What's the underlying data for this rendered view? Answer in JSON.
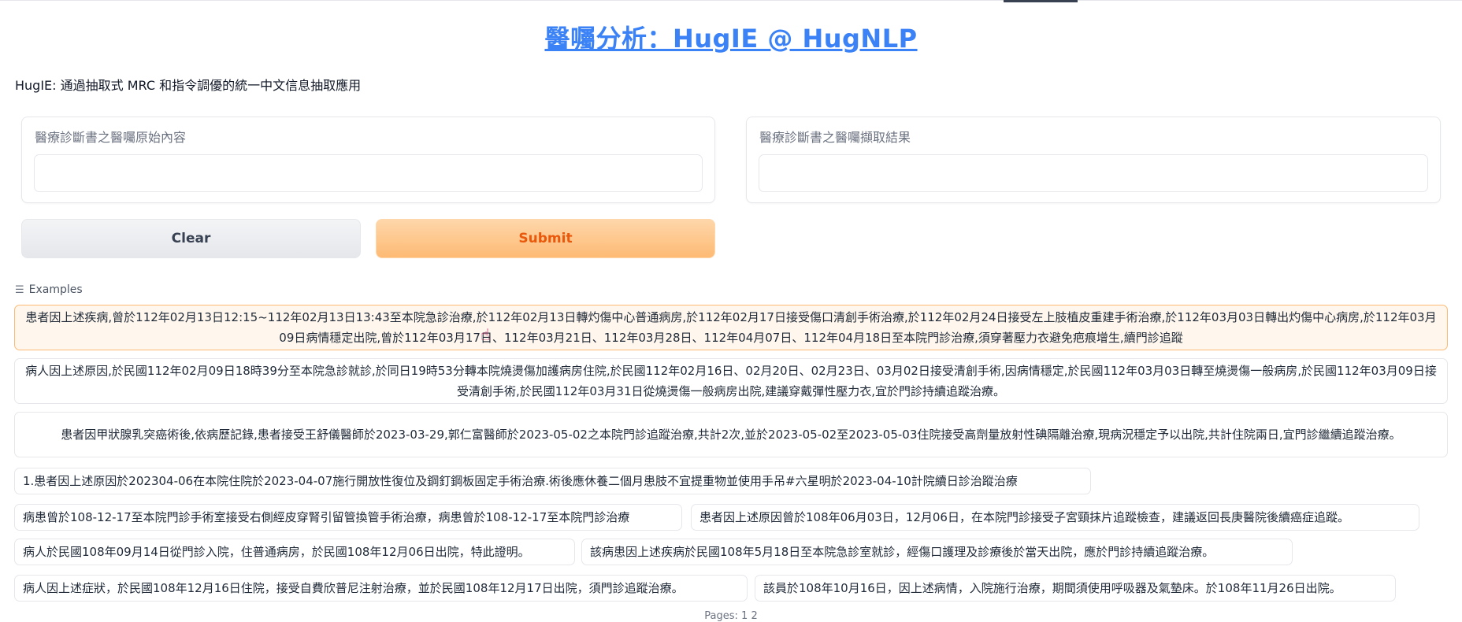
{
  "header": {
    "title": "醫囑分析：HugIE @ HugNLP",
    "subtitle": "HugIE: 通過抽取式 MRC 和指令調優的統一中文信息抽取應用"
  },
  "input_panel": {
    "label": "醫療診斷書之醫囑原始內容",
    "value": ""
  },
  "output_panel": {
    "label": "醫療診斷書之醫囑擷取結果",
    "value": ""
  },
  "buttons": {
    "clear": "Clear",
    "submit": "Submit"
  },
  "examples": {
    "title": "Examples",
    "icon": "list-icon",
    "items": [
      "患者因上述疾病,曾於112年02月13日12:15~112年02月13日13:43至本院急診治療,於112年02月13日轉灼傷中心普通病房,於112年02月17日接受傷口清創手術治療,於112年02月24日接受左上肢植皮重建手術治療,於112年03月03日轉出灼傷中心病房,於112年03月09日病情穩定出院,曾於112年03月17日、112年03月21日、112年03月28日、112年04月07日、112年04月18日至本院門診治療,須穿著壓力衣避免疤痕增生,續門診追蹤",
      "病人因上述原因,於民國112年02月09日18時39分至本院急診就診,於同日19時53分轉本院燒燙傷加護病房住院,於民國112年02月16日、02月20日、02月23日、03月02日接受清創手術,因病情穩定,於民國112年03月03日轉至燒燙傷一般病房,於民國112年03月09日接受清創手術,於民國112年03月31日從燒燙傷一般病房出院,建議穿戴彈性壓力衣,宜於門診持續追蹤治療。",
      "患者因甲狀腺乳突癌術後,依病歷記錄,患者接受王舒儀醫師於2023-03-29,郭仁富醫師於2023-05-02之本院門診追蹤治療,共計2次,並於2023-05-02至2023-05-03住院接受高劑量放射性碘隔離治療,現病況穩定予以出院,共計住院兩日,宜門診繼續追蹤治療。",
      "1.患者因上述原因於202304-06在本院住院於2023-04-07施行開放性復位及鋼釘鋼板固定手術治療.術後應休養二個月患肢不宜提重物並使用手吊#六星明於2023-04-10計院續日診治蹤治療",
      "病患曾於108-12-17至本院門診手術室接受右側經皮穿腎引留管換管手術治療，病患曾於108-12-17至本院門診治療",
      "患者因上述原因曾於108年06月03日，12月06日，在本院門診接受子宮頸抹片追蹤檢查，建議返回長庚醫院後續癌症追蹤。",
      "病人於民國108年09月14日從門診入院，住普通病房，於民國108年12月06日出院，特此證明。",
      "該病患因上述疾病於民國108年5月18日至本院急診室就診，經傷口護理及診療後於當天出院，應於門診持續追蹤治療。",
      "病人因上述症狀，於民國108年12月16日住院，接受自費欣普尼注射治療，並於民國108年12月17日出院，須門診追蹤治療。",
      "該員於108年10月16日，因上述病情，入院施行治療，期間須使用呼吸器及氣墊床。於108年11月26日出院。"
    ]
  },
  "pagination": "Pages: 1 2"
}
